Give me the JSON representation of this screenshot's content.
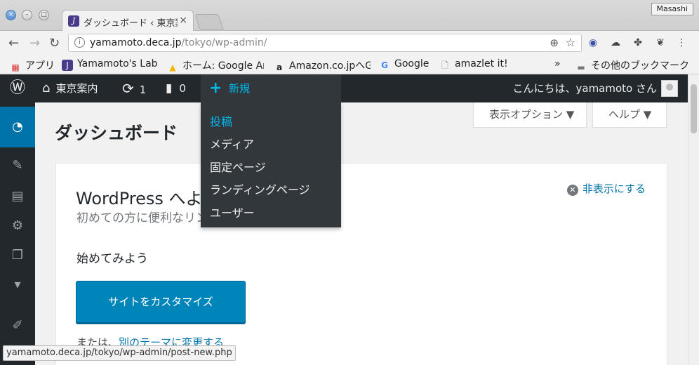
{
  "browser": {
    "tab_title": "ダッシュボード ‹ 東京案内",
    "user_badge": "Masashi",
    "url_host": "yamamoto.deca.jp",
    "url_path": "/tokyo/wp-admin/",
    "bookmarks": [
      {
        "label": "アプリ",
        "icon": "apps-grid-icon"
      },
      {
        "label": "Yamamoto's Lab",
        "icon": "lab-favicon"
      },
      {
        "label": "ホーム: Google Ana",
        "icon": "analytics-icon"
      },
      {
        "label": "Amazon.co.jpへG",
        "icon": "amazon-icon"
      },
      {
        "label": "Google",
        "icon": "google-icon"
      },
      {
        "label": "amazlet it!",
        "icon": "page-icon"
      }
    ],
    "bookmarks_overflow": "»",
    "other_bookmarks": "その他のブックマーク",
    "status_url": "yamamoto.deca.jp/tokyo/wp-admin/post-new.php"
  },
  "adminbar": {
    "site_name": "東京案内",
    "updates_count": "1",
    "comments_count": "0",
    "new_label": "新規",
    "greeting": "こんにちは、yamamoto さん"
  },
  "new_menu": {
    "items": [
      "投稿",
      "メディア",
      "固定ページ",
      "ランディングページ",
      "ユーザー"
    ]
  },
  "screen_meta": {
    "options_label": "表示オプション ▼",
    "help_label": "ヘルプ ▼"
  },
  "dashboard": {
    "title": "ダッシュボード",
    "welcome_heading": "WordPress へようこそ !",
    "welcome_about": "初めての方に便利なリンクを集めました。",
    "dismiss_label": "非表示にする",
    "get_started": "始めてみよう",
    "customize_button": "サイトをカスタマイズ",
    "or_text": "または、",
    "change_theme_link": "別のテーマに変更する"
  },
  "colors": {
    "wp_dark": "#23282d",
    "wp_submenu": "#32373c",
    "wp_accent": "#00b9eb",
    "wp_primary": "#0085ba"
  }
}
